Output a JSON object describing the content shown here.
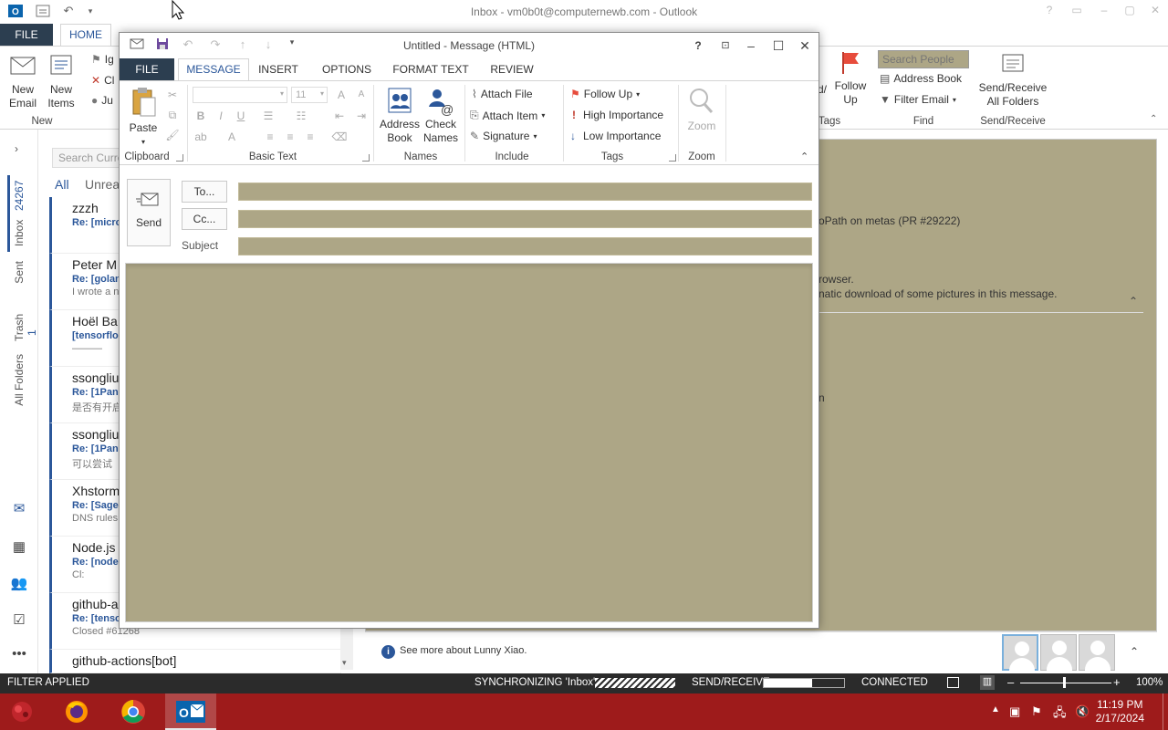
{
  "outlook": {
    "window_title": "Inbox - vm0b0t@computernewb.com - Outlook",
    "tabs": {
      "file": "FILE",
      "home": "HOME"
    },
    "ribbon": {
      "new_email": "New\nEmail",
      "new_items": "New\nItems",
      "group_new": "New",
      "ignore_partial": "Ig",
      "clean_partial": "Cl",
      "junk_partial": "Ju",
      "follow_up": "Follow\nUp",
      "tags_partial": "Tags",
      "follow_partial": "d/",
      "search_people_placeholder": "Search People",
      "address_book": "Address Book",
      "filter_email": "Filter Email",
      "group_find": "Find",
      "send_receive_all": "Send/Receive\nAll Folders",
      "group_send_receive": "Send/Receive"
    },
    "leftnav": {
      "inbox": "Inbox",
      "inbox_count": "24267",
      "sent": "Sent",
      "trash": "Trash",
      "trash_count": "1",
      "all_folders": "All Folders"
    },
    "list": {
      "search_placeholder": "Search Curre",
      "filter_all": "All",
      "filter_unread": "Unrea",
      "items": [
        {
          "from": "zzzh",
          "subject": "Re: [micro",
          "preview": ""
        },
        {
          "from": "Peter M",
          "subject": "Re: [golan",
          "preview": "I wrote a n"
        },
        {
          "from": "Hoël Ba",
          "subject": "[tensorflo",
          "preview": "———"
        },
        {
          "from": "ssongliu",
          "subject": "Re: [1Pane",
          "preview": "是否有开启"
        },
        {
          "from": "ssongliu",
          "subject": "Re: [1Pane",
          "preview": "可以尝试"
        },
        {
          "from": "Xhstorm",
          "subject": "Re: [Sager",
          "preview": "DNS rules"
        },
        {
          "from": "Node.js",
          "subject": "Re: [node",
          "preview": "Cl:"
        },
        {
          "from": "github-a",
          "subject": "Re: [tenso",
          "preview": "Closed #61268"
        },
        {
          "from": "github-actions[bot]",
          "subject": "",
          "preview": ""
        }
      ]
    },
    "reading": {
      "subject_partial": "oPath on metas (PR #29222)",
      "browser_partial": "rowser.",
      "download_partial": "natic download of some pictures in this message.",
      "char_partial": "n",
      "see_more": "See more about Lunny Xiao."
    },
    "status": {
      "filter": "FILTER APPLIED",
      "sync": "SYNCHRONIZING  'Inbox'",
      "send_receive": "SEND/RECEIVE",
      "connected": "CONNECTED",
      "zoom": "100%",
      "send_receive_progress": 0.6
    }
  },
  "compose": {
    "title": "Untitled - Message (HTML)",
    "tabs": [
      "FILE",
      "MESSAGE",
      "INSERT",
      "OPTIONS",
      "FORMAT TEXT",
      "REVIEW"
    ],
    "ribbon": {
      "paste": "Paste",
      "clipboard": "Clipboard",
      "font_size": "11",
      "basic_text": "Basic Text",
      "address_book": "Address\nBook",
      "check_names": "Check\nNames",
      "names": "Names",
      "attach_file": "Attach File",
      "attach_item": "Attach Item",
      "signature": "Signature",
      "include": "Include",
      "follow_up": "Follow Up",
      "high_importance": "High Importance",
      "low_importance": "Low Importance",
      "tags": "Tags",
      "zoom": "Zoom",
      "zoom_group": "Zoom"
    },
    "header": {
      "send": "Send",
      "to": "To...",
      "cc": "Cc...",
      "subject": "Subject"
    }
  },
  "taskbar": {
    "time": "11:19 PM",
    "date": "2/17/2024"
  }
}
